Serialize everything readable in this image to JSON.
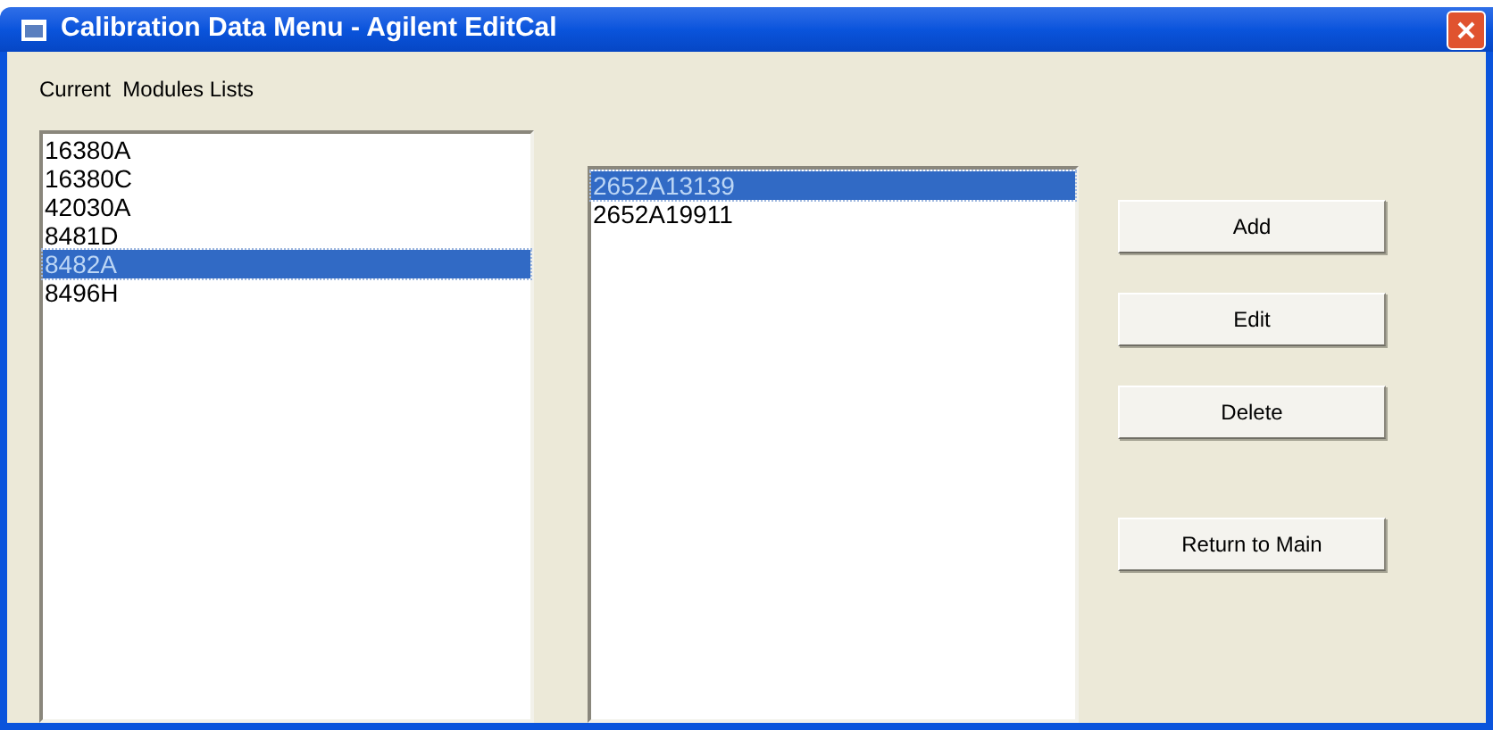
{
  "window": {
    "title": "Calibration Data Menu - Agilent EditCal"
  },
  "label": "Current  Modules Lists",
  "modules": [
    {
      "text": "16380A",
      "selected": false
    },
    {
      "text": "16380C",
      "selected": false
    },
    {
      "text": "42030A",
      "selected": false
    },
    {
      "text": "8481D",
      "selected": false
    },
    {
      "text": "8482A",
      "selected": true
    },
    {
      "text": "8496H",
      "selected": false
    }
  ],
  "serials": [
    {
      "text": "2652A13139",
      "selected": true
    },
    {
      "text": "2652A19911",
      "selected": false
    }
  ],
  "buttons": [
    "Add",
    "Edit",
    "Delete",
    "Return to Main"
  ]
}
